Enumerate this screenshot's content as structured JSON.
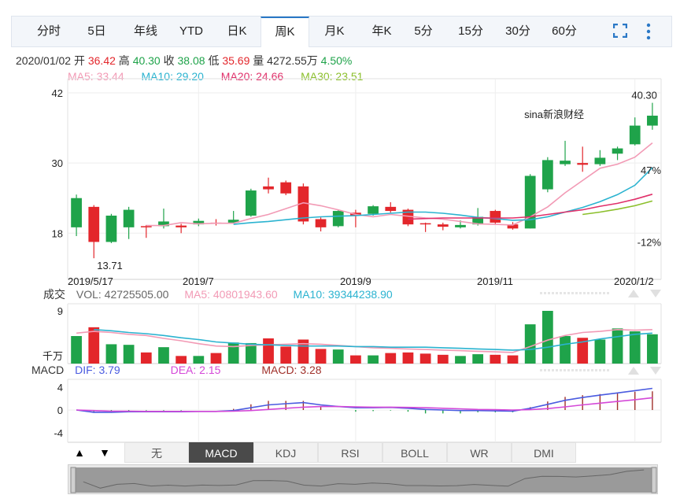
{
  "tabs": [
    "分时",
    "5日",
    "年线",
    "YTD",
    "日K",
    "周K",
    "月K",
    "年K",
    "5分",
    "15分",
    "30分",
    "60分"
  ],
  "active_tab": "周K",
  "quote": {
    "date": "2020/01/02",
    "open_label": "开",
    "open": "36.42",
    "high_label": "高",
    "high": "40.30",
    "close_label": "收",
    "close": "38.08",
    "low_label": "低",
    "low": "35.69",
    "volume_label": "量",
    "volume": "4272.55万",
    "change_pct": "4.50%"
  },
  "ma_line": {
    "ma5": "MA5: 33.44",
    "ma10": "MA10: 29.20",
    "ma20": "MA20: 24.66",
    "ma30": "MA30: 23.51"
  },
  "colors": {
    "up": "#e3262b",
    "down": "#1fa34a",
    "ma5": "#f29ab5",
    "ma10": "#2bb3d0",
    "ma20": "#e0306a",
    "ma30": "#8bbf2b",
    "dif": "#4a5be0",
    "dea": "#d448d8",
    "macd": "#a0302a"
  },
  "watermark": "sina新浪财经",
  "volume_bar": {
    "title": "成交",
    "vol": "VOL: 42725505.00",
    "ma5": "MA5: 40801943.60",
    "ma10": "MA10: 39344238.90",
    "max_label": "9",
    "unit_label": "千万"
  },
  "macd_bar": {
    "title": "MACD",
    "dif": "DIF: 3.79",
    "dea": "DEA: 2.15",
    "macd": "MACD: 3.28",
    "ticks": [
      "4",
      "0",
      "-4"
    ]
  },
  "indicator_tabs": [
    "无",
    "MACD",
    "KDJ",
    "RSI",
    "BOLL",
    "WR",
    "DMI"
  ],
  "active_indicator": "MACD",
  "chart_data": {
    "type": "candlestick",
    "y_ticks": [
      "42",
      "30",
      "18"
    ],
    "pct_labels": [
      "47%",
      "-12%"
    ],
    "x_labels": [
      "2019/5/17",
      "2019/7",
      "2019/9",
      "2019/11",
      "2020/1/2"
    ],
    "max_label": "40.30",
    "min_label": "13.71",
    "candles": [
      {
        "o": 19.0,
        "c": 24.0,
        "h": 24.6,
        "l": 17.5
      },
      {
        "o": 22.5,
        "c": 16.5,
        "h": 22.8,
        "l": 13.71
      },
      {
        "o": 16.5,
        "c": 21.0,
        "h": 21.3,
        "l": 16.3
      },
      {
        "o": 19.0,
        "c": 22.0,
        "h": 22.5,
        "l": 17.0
      },
      {
        "o": 19.2,
        "c": 19.0,
        "h": 19.4,
        "l": 17.2
      },
      {
        "o": 19.2,
        "c": 20.0,
        "h": 22.2,
        "l": 18.8
      },
      {
        "o": 19.3,
        "c": 19.0,
        "h": 19.6,
        "l": 18.0
      },
      {
        "o": 19.5,
        "c": 20.1,
        "h": 20.5,
        "l": 19.2
      },
      {
        "o": 19.8,
        "c": 19.6,
        "h": 20.4,
        "l": 19.3
      },
      {
        "o": 19.8,
        "c": 20.3,
        "h": 21.8,
        "l": 19.6
      },
      {
        "o": 21.0,
        "c": 25.3,
        "h": 25.6,
        "l": 20.8
      },
      {
        "o": 26.0,
        "c": 25.5,
        "h": 27.5,
        "l": 24.8
      },
      {
        "o": 26.7,
        "c": 24.8,
        "h": 27.0,
        "l": 24.5
      },
      {
        "o": 26.0,
        "c": 20.0,
        "h": 26.5,
        "l": 19.5
      },
      {
        "o": 20.4,
        "c": 19.0,
        "h": 20.7,
        "l": 18.3
      },
      {
        "o": 19.2,
        "c": 21.8,
        "h": 22.0,
        "l": 19.0
      },
      {
        "o": 21.5,
        "c": 21.0,
        "h": 22.0,
        "l": 19.0
      },
      {
        "o": 21.3,
        "c": 22.6,
        "h": 22.8,
        "l": 21.0
      },
      {
        "o": 22.5,
        "c": 21.8,
        "h": 23.3,
        "l": 21.5
      },
      {
        "o": 22.0,
        "c": 19.5,
        "h": 22.2,
        "l": 19.2
      },
      {
        "o": 19.7,
        "c": 19.5,
        "h": 19.8,
        "l": 18.2
      },
      {
        "o": 19.5,
        "c": 19.1,
        "h": 19.8,
        "l": 18.5
      },
      {
        "o": 19.0,
        "c": 19.4,
        "h": 20.2,
        "l": 18.8
      },
      {
        "o": 19.5,
        "c": 20.8,
        "h": 22.3,
        "l": 19.3
      },
      {
        "o": 21.8,
        "c": 19.8,
        "h": 22.0,
        "l": 19.5
      },
      {
        "o": 19.5,
        "c": 18.8,
        "h": 19.9,
        "l": 18.6
      },
      {
        "o": 18.8,
        "c": 27.8,
        "h": 28.1,
        "l": 18.8
      },
      {
        "o": 25.5,
        "c": 30.5,
        "h": 31.0,
        "l": 25.0
      },
      {
        "o": 29.8,
        "c": 30.4,
        "h": 33.8,
        "l": 29.5
      },
      {
        "o": 30.0,
        "c": 29.7,
        "h": 32.8,
        "l": 28.5
      },
      {
        "o": 29.8,
        "c": 30.9,
        "h": 32.2,
        "l": 29.5
      },
      {
        "o": 31.6,
        "c": 32.5,
        "h": 32.8,
        "l": 30.5
      },
      {
        "o": 33.2,
        "c": 36.4,
        "h": 37.8,
        "l": 33.0
      },
      {
        "o": 36.4,
        "c": 38.1,
        "h": 40.3,
        "l": 35.69
      }
    ],
    "ma5": [
      null,
      null,
      null,
      null,
      19.3,
      19.3,
      19.8,
      19.6,
      19.7,
      19.7,
      20.5,
      21.2,
      22.2,
      23.2,
      22.7,
      22.0,
      21.2,
      20.8,
      21.2,
      20.9,
      20.6,
      20.4,
      20.0,
      19.6,
      19.5,
      19.4,
      20.8,
      22.5,
      24.9,
      27.0,
      29.1,
      29.8,
      31.0,
      33.44
    ],
    "ma10": [
      null,
      null,
      null,
      null,
      null,
      null,
      null,
      null,
      null,
      19.5,
      19.8,
      20.0,
      20.3,
      20.6,
      20.8,
      20.9,
      21.0,
      21.2,
      21.4,
      21.6,
      21.6,
      21.4,
      21.1,
      20.7,
      20.5,
      20.2,
      20.3,
      20.8,
      21.6,
      22.4,
      23.4,
      24.6,
      26.2,
      29.2
    ],
    "ma20": [
      null,
      null,
      null,
      null,
      null,
      null,
      null,
      null,
      null,
      null,
      null,
      null,
      null,
      null,
      null,
      null,
      null,
      null,
      null,
      20.4,
      20.5,
      20.6,
      20.6,
      20.6,
      20.6,
      20.6,
      20.8,
      21.2,
      21.6,
      22.0,
      22.6,
      23.1,
      23.8,
      24.66
    ],
    "ma30": [
      null,
      null,
      null,
      null,
      null,
      null,
      null,
      null,
      null,
      null,
      null,
      null,
      null,
      null,
      null,
      null,
      null,
      null,
      null,
      null,
      null,
      null,
      null,
      null,
      null,
      null,
      null,
      null,
      null,
      21.2,
      21.6,
      22.1,
      22.7,
      23.51
    ],
    "vol_ma5": [
      5.2,
      5.5,
      5.3,
      5.0,
      4.8,
      4.3,
      3.9,
      3.4,
      3.0,
      2.9,
      3.1,
      3.2,
      3.3,
      3.4,
      3.3,
      3.1,
      2.9,
      2.7,
      2.6,
      2.5,
      2.4,
      2.3,
      2.2,
      2.1,
      2.0,
      1.9,
      2.9,
      4.0,
      4.8,
      5.3,
      5.5,
      5.8,
      5.7,
      5.8
    ],
    "vol_ma10": [
      null,
      5.8,
      5.6,
      5.3,
      5.1,
      4.8,
      4.4,
      4.1,
      3.7,
      3.5,
      3.3,
      3.2,
      3.1,
      3.0,
      3.0,
      3.0,
      2.9,
      2.9,
      2.8,
      2.8,
      2.8,
      2.7,
      2.6,
      2.5,
      2.4,
      2.3,
      2.4,
      2.8,
      3.3,
      3.7,
      4.2,
      4.6,
      5.0,
      5.2
    ],
    "volumes": [
      4.7,
      6.2,
      3.3,
      3.2,
      1.9,
      2.8,
      1.3,
      1.3,
      1.8,
      3.6,
      3.5,
      4.3,
      2.9,
      4.1,
      2.5,
      2.4,
      1.4,
      1.4,
      1.8,
      1.9,
      1.7,
      1.5,
      1.3,
      1.6,
      1.5,
      1.4,
      6.7,
      9.0,
      4.7,
      4.4,
      4.1,
      6.0,
      5.5,
      5.0
    ],
    "macd_dif": [
      0,
      -0.4,
      -0.4,
      -0.3,
      -0.3,
      -0.3,
      -0.3,
      -0.25,
      -0.25,
      -0.1,
      0.4,
      0.9,
      1.1,
      1.3,
      0.9,
      0.6,
      0.4,
      0.4,
      0.45,
      0.3,
      0.1,
      0,
      -0.1,
      -0.1,
      -0.15,
      -0.2,
      0.3,
      1.0,
      1.7,
      2.2,
      2.6,
      3.0,
      3.4,
      3.79
    ],
    "macd_dea": [
      0,
      -0.1,
      -0.2,
      -0.2,
      -0.25,
      -0.25,
      -0.25,
      -0.25,
      -0.25,
      -0.2,
      -0.1,
      0.1,
      0.3,
      0.5,
      0.6,
      0.6,
      0.55,
      0.5,
      0.5,
      0.45,
      0.4,
      0.3,
      0.2,
      0.1,
      0.05,
      0,
      0.05,
      0.25,
      0.55,
      0.9,
      1.2,
      1.5,
      1.8,
      2.15
    ],
    "macd_hist": [
      0,
      -0.5,
      -0.4,
      -0.2,
      -0.1,
      -0.1,
      -0.1,
      0,
      0,
      0.2,
      1.0,
      1.6,
      1.6,
      1.6,
      0.6,
      0,
      -0.3,
      -0.2,
      -0.1,
      -0.3,
      -0.6,
      -0.6,
      -0.6,
      -0.4,
      -0.4,
      -0.4,
      0.5,
      1.5,
      2.3,
      2.6,
      2.8,
      3.0,
      3.2,
      3.28
    ]
  }
}
